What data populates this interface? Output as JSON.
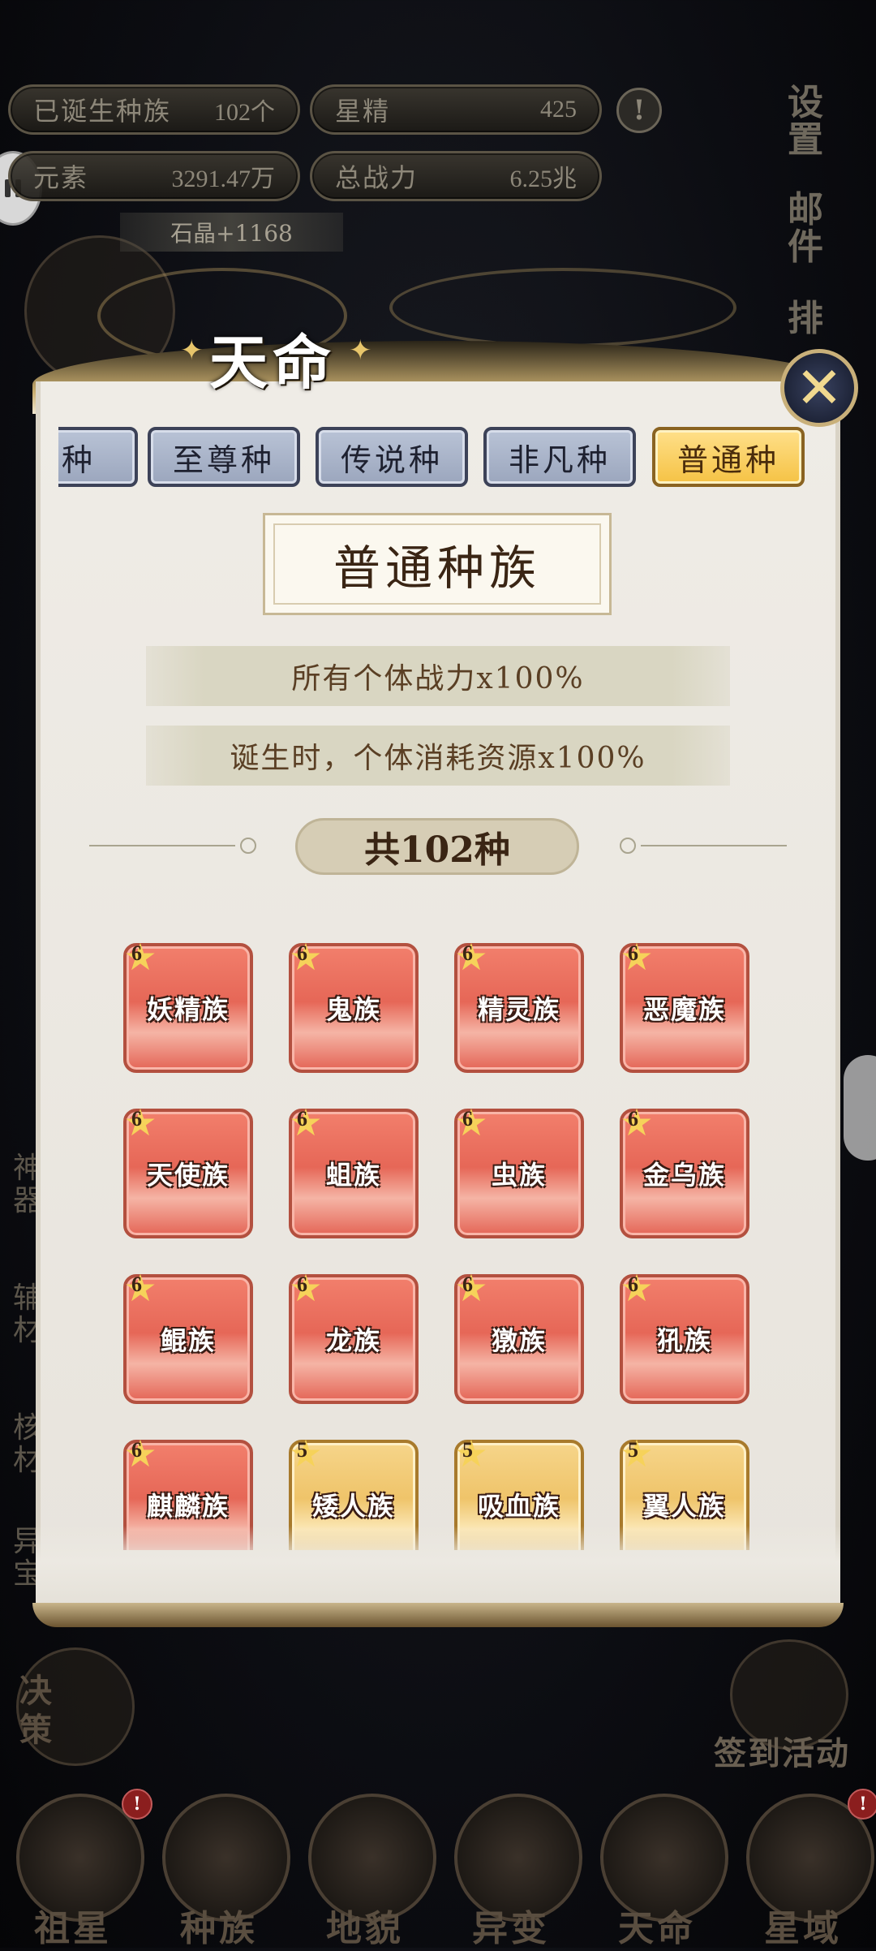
{
  "hud": {
    "born_species_label": "已诞生种族",
    "born_species_value": "102个",
    "star_essence_label": "星精",
    "star_essence_value": "425",
    "element_label": "元素",
    "element_value": "3291.47万",
    "total_power_label": "总战力",
    "total_power_value": "6.25兆",
    "crystal_gain": "石晶+1168"
  },
  "right_menu": {
    "settings": "设置",
    "mail": "邮件",
    "rank_partial": "排"
  },
  "modal": {
    "title": "天命",
    "tabs": [
      {
        "label": "命种",
        "active": false
      },
      {
        "label": "至尊种",
        "active": false
      },
      {
        "label": "传说种",
        "active": false
      },
      {
        "label": "非凡种",
        "active": false
      },
      {
        "label": "普通种",
        "active": true
      }
    ],
    "rank_title": "普通种族",
    "buffs": [
      "所有个体战力x100%",
      "诞生时，个体消耗资源x100%"
    ],
    "count_label": "共102种",
    "species": [
      {
        "name": "妖精族",
        "stars": "6",
        "tier": "red"
      },
      {
        "name": "鬼族",
        "stars": "6",
        "tier": "red"
      },
      {
        "name": "精灵族",
        "stars": "6",
        "tier": "red"
      },
      {
        "name": "恶魔族",
        "stars": "6",
        "tier": "red"
      },
      {
        "name": "天使族",
        "stars": "6",
        "tier": "red"
      },
      {
        "name": "蛆族",
        "stars": "6",
        "tier": "red"
      },
      {
        "name": "虫族",
        "stars": "6",
        "tier": "red"
      },
      {
        "name": "金乌族",
        "stars": "6",
        "tier": "red"
      },
      {
        "name": "鲲族",
        "stars": "6",
        "tier": "red"
      },
      {
        "name": "龙族",
        "stars": "6",
        "tier": "red"
      },
      {
        "name": "獤族",
        "stars": "6",
        "tier": "red"
      },
      {
        "name": "犼族",
        "stars": "6",
        "tier": "red"
      },
      {
        "name": "麒麟族",
        "stars": "6",
        "tier": "red"
      },
      {
        "name": "矮人族",
        "stars": "5",
        "tier": "gold"
      },
      {
        "name": "吸血族",
        "stars": "5",
        "tier": "gold"
      },
      {
        "name": "翼人族",
        "stars": "5",
        "tier": "gold"
      }
    ]
  },
  "side_left_labels": [
    "神器",
    "辅材",
    "核材",
    "异宝"
  ],
  "decision_label": "决策",
  "sign_in_label": "签到活动",
  "bottom_nav": [
    {
      "label": "祖星",
      "badge": "!"
    },
    {
      "label": "种族"
    },
    {
      "label": "地貌"
    },
    {
      "label": "异变"
    },
    {
      "label": "天命"
    },
    {
      "label": "星域",
      "badge": "!"
    }
  ],
  "colors": {
    "accent_gold": "#f5c244",
    "card_red": "#e66757",
    "card_gold": "#efc46a",
    "tab_inactive": "#9ba6bd",
    "badge_red": "#8b1e1e"
  }
}
